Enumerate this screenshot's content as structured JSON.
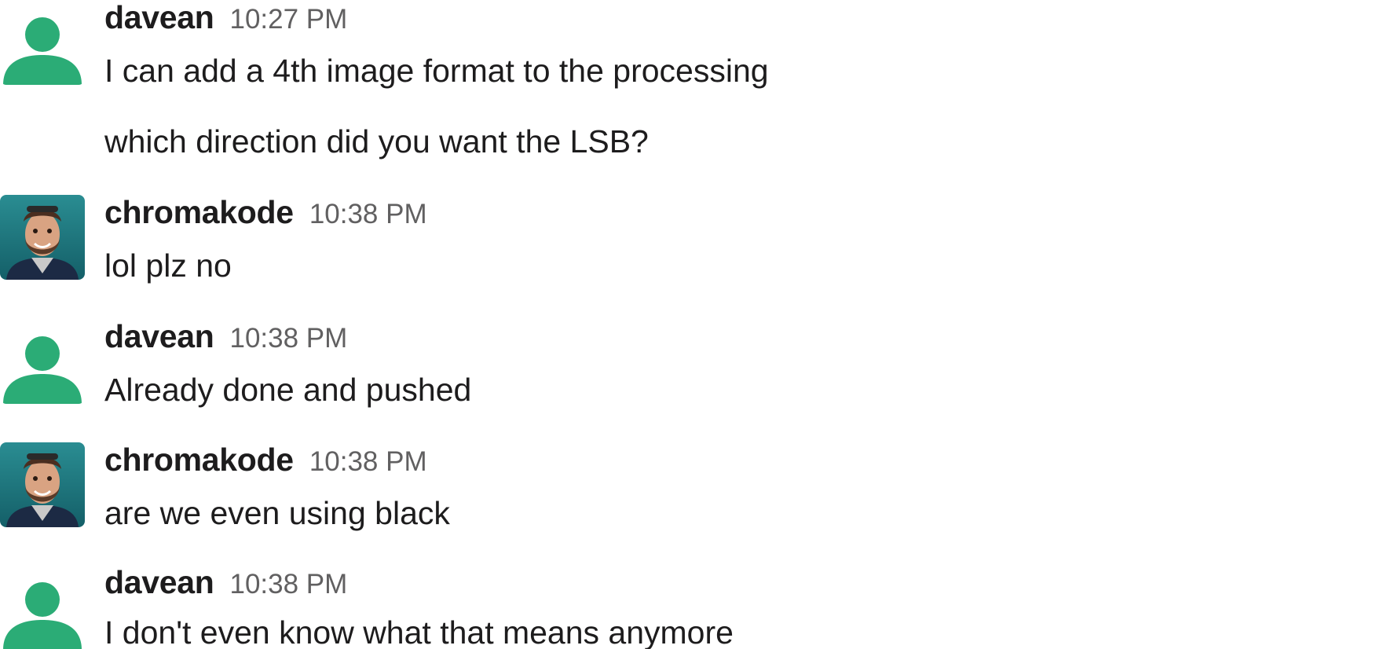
{
  "messages": [
    {
      "author": "davean",
      "time": "10:27 PM",
      "avatar": "default-person-icon",
      "lines": [
        "I can add a 4th image format to the processing",
        "which direction did you want the LSB?"
      ]
    },
    {
      "author": "chromakode",
      "time": "10:38 PM",
      "avatar": "profile-photo",
      "lines": [
        "lol plz no"
      ]
    },
    {
      "author": "davean",
      "time": "10:38 PM",
      "avatar": "default-person-icon",
      "lines": [
        "Already done and pushed"
      ]
    },
    {
      "author": "chromakode",
      "time": "10:38 PM",
      "avatar": "profile-photo",
      "lines": [
        "are we even using black"
      ]
    },
    {
      "author": "davean",
      "time": "10:38 PM",
      "avatar": "default-person-icon",
      "lines": [
        "I don't even know what that means anymore"
      ]
    }
  ],
  "colors": {
    "default_avatar": "#2bac76",
    "photo_bg": "#1e7f86",
    "author_text": "#1d1c1d",
    "timestamp_text": "#616061"
  }
}
